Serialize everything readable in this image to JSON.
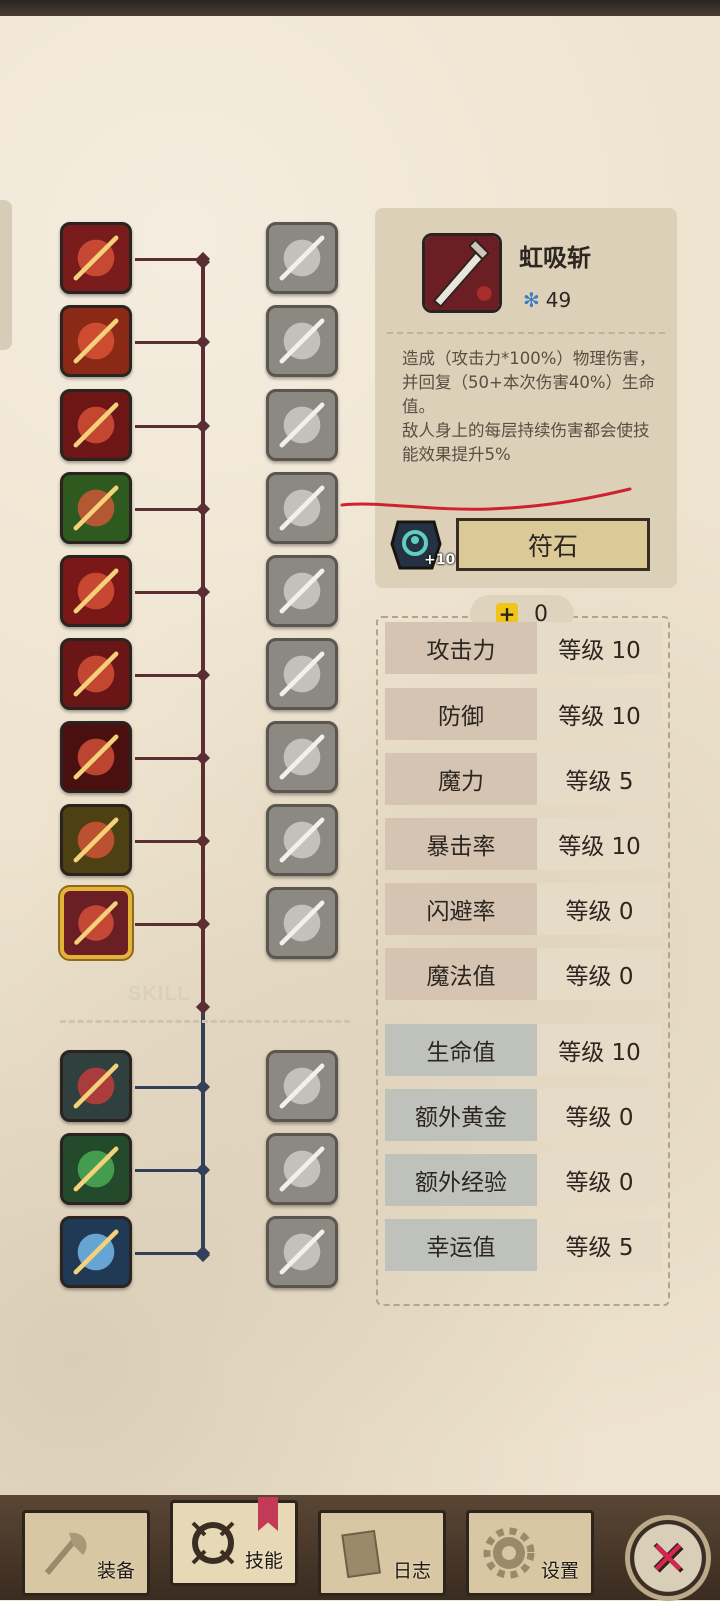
{
  "skill": {
    "name": "虹吸斩",
    "cost": "49",
    "description": "造成（攻击力*100%）物理伤害，并回复（50+本次伤害40%）生命值。\n敌人身上的每层持续伤害都会使技能效果提升5%",
    "rune_plus": "+10",
    "rune_button": "符石",
    "tree_watermark": "SKILL"
  },
  "points": "0",
  "stats": [
    {
      "name": "攻击力",
      "level": "等级 10"
    },
    {
      "name": "防御",
      "level": "等级 10"
    },
    {
      "name": "魔力",
      "level": "等级 5"
    },
    {
      "name": "暴击率",
      "level": "等级 10"
    },
    {
      "name": "闪避率",
      "level": "等级 0"
    },
    {
      "name": "魔法值",
      "level": "等级 0"
    },
    {
      "name": "生命值",
      "level": "等级 10"
    },
    {
      "name": "额外黄金",
      "level": "等级 0"
    },
    {
      "name": "额外经验",
      "level": "等级 0"
    },
    {
      "name": "幸运值",
      "level": "等级 5"
    }
  ],
  "nav": {
    "equipment": "装备",
    "skills": "技能",
    "journal": "日志",
    "settings": "设置"
  },
  "icons": {
    "active_skills": [
      "blade-slash-icon",
      "fire-dash-icon",
      "rage-scream-icon",
      "muscle-flex-icon",
      "shadow-strike-icon",
      "dagger-icon",
      "ninja-icon",
      "golden-warrior-icon",
      "siphon-sword-icon"
    ],
    "locked_skills": [
      "shield-cross-icon",
      "lightning-fist-icon",
      "thunder-icon",
      "speed-runner-icon",
      "dust-cloud-icon",
      "eye-burst-icon",
      "fish-icon",
      "vortex-icon",
      "sparkle-figure-icon"
    ],
    "lower_active": [
      "chest-down-icon",
      "chest-hand-icon",
      "spirit-figure-icon"
    ],
    "lower_locked": [
      "eye-chest-icon",
      "eye-chest-open-icon",
      "question-figure-icon"
    ]
  },
  "colors": {
    "selected_border": "#e5b33a",
    "red_tree": "#5a2f33",
    "blue_tree": "#34405a",
    "accent_yellow": "#f0c419",
    "close_red": "#d6264f"
  }
}
